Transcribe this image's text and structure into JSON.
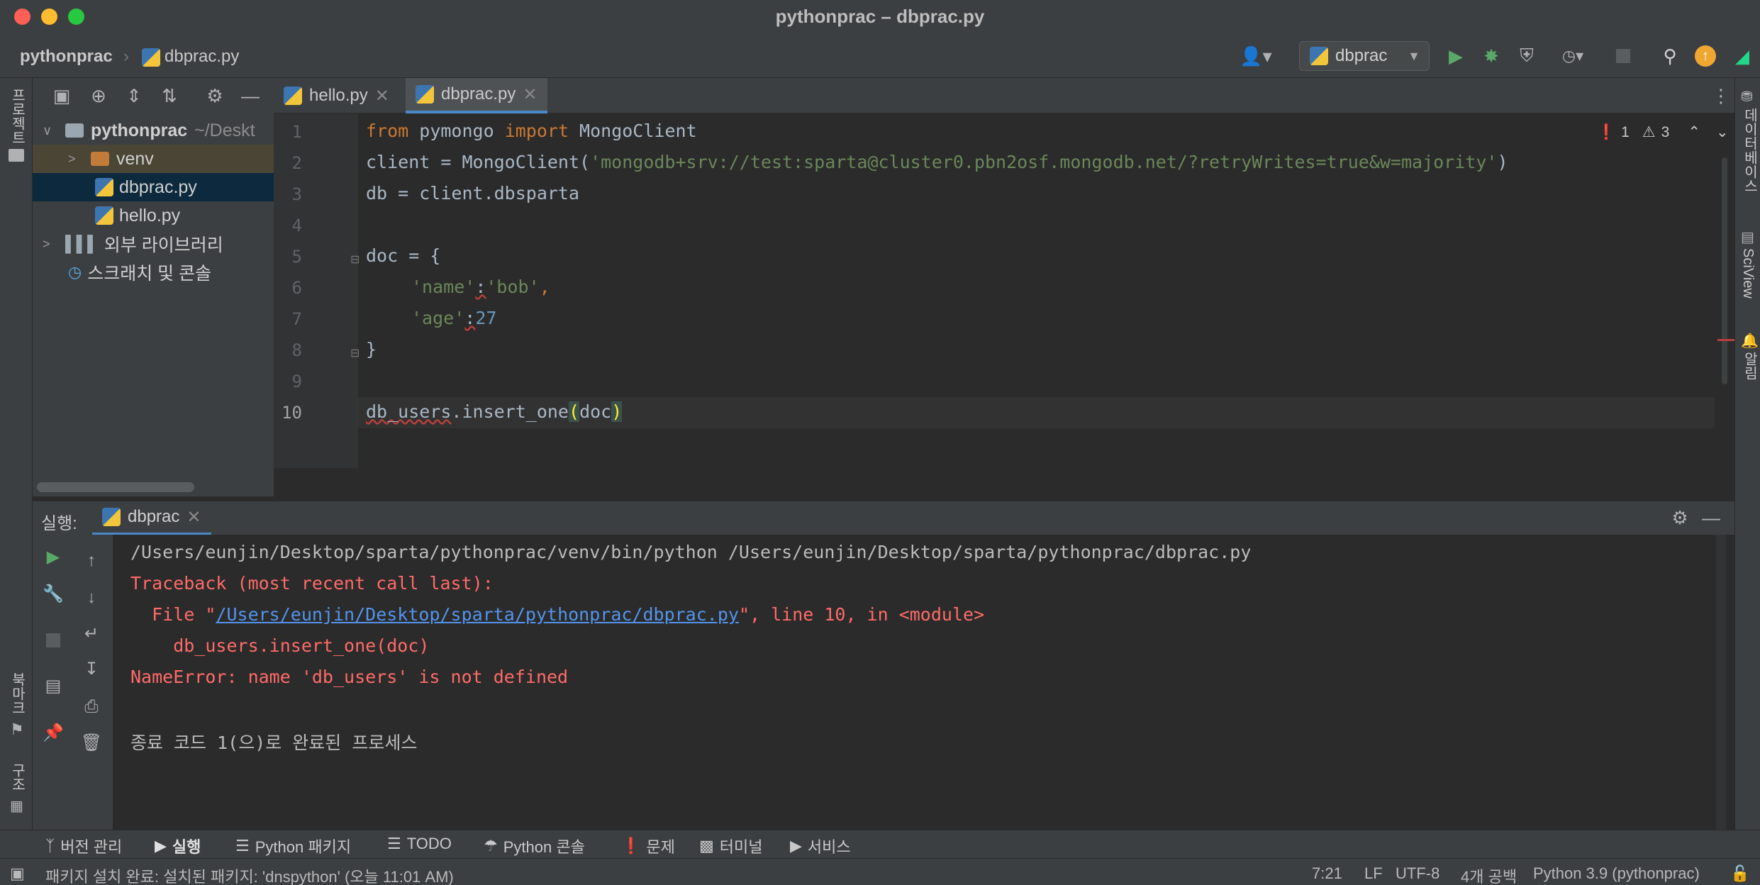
{
  "window": {
    "title": "pythonprac – dbprac.py",
    "colors": {
      "close": "#ff5f57",
      "minimize": "#febc2e",
      "maximize": "#28c840"
    }
  },
  "breadcrumb": {
    "project": "pythonprac",
    "file": "dbprac.py"
  },
  "toolbar": {
    "run_config": "dbprac",
    "icons": [
      "account-icon",
      "run-icon",
      "debug-icon",
      "coverage-icon",
      "profile-icon",
      "stop-icon",
      "search-icon",
      "update-icon",
      "jetbrains-icon"
    ]
  },
  "left_strip": {
    "project_label": "프로젝트",
    "bookmarks_label": "북마크",
    "structure_label": "구조"
  },
  "right_strip": {
    "database_label": "데이터베이스",
    "sciview_label": "SciView",
    "notifications_label": "알림"
  },
  "project_tree": {
    "root": "pythonprac",
    "root_path": "~/Deskt",
    "items": [
      {
        "label": "venv",
        "type": "folder"
      },
      {
        "label": "dbprac.py",
        "type": "python",
        "selected": true
      },
      {
        "label": "hello.py",
        "type": "python"
      },
      {
        "label": "외부 라이브러리",
        "type": "library"
      },
      {
        "label": "스크래치 및 콘솔",
        "type": "scratch"
      }
    ]
  },
  "editor": {
    "tabs": [
      {
        "label": "hello.py",
        "active": false
      },
      {
        "label": "dbprac.py",
        "active": true
      }
    ],
    "inspection": {
      "errors": "1",
      "warnings": "3"
    },
    "line_numbers": [
      "1",
      "2",
      "3",
      "4",
      "5",
      "6",
      "7",
      "8",
      "9",
      "10"
    ],
    "code": {
      "l1_from": "from",
      "l1_module": " pymongo ",
      "l1_import": "import",
      "l1_name": " MongoClient",
      "l2_head": "client = MongoClient(",
      "l2_str": "'mongodb+srv://test:sparta@cluster0.pbn2osf.mongodb.net/?retryWrites=true&w=majority'",
      "l2_tail": ")",
      "l3": "db = client.dbsparta",
      "l5": "doc = {",
      "l6_key": "'name'",
      "l6_colon": ":",
      "l6_val": "'bob'",
      "l6_comma": ",",
      "l7_key": "'age'",
      "l7_colon": ":",
      "l7_val": "27",
      "l8": "}",
      "l10_name": "db_users",
      "l10_call": ".insert_one",
      "l10_open": "(",
      "l10_arg": "doc",
      "l10_close": ")"
    }
  },
  "run_panel": {
    "label": "실행:",
    "tab": "dbprac",
    "output": {
      "cmd": "/Users/eunjin/Desktop/sparta/pythonprac/venv/bin/python /Users/eunjin/Desktop/sparta/pythonprac/dbprac.py",
      "traceback": "Traceback (most recent call last):",
      "file_prefix": "  File \"",
      "file_link": "/Users/eunjin/Desktop/sparta/pythonprac/dbprac.py",
      "file_suffix": "\", line 10, in <module>",
      "code_line": "    db_users.insert_one(doc)",
      "error": "NameError: name 'db_users' is not defined",
      "exit": "종료 코드 1(으)로 완료된 프로세스"
    }
  },
  "bottom_tools": [
    "버전 관리",
    "실행",
    "Python 패키지",
    "TODO",
    "Python 콘솔",
    "문제",
    "터미널",
    "서비스"
  ],
  "status_bar": {
    "message": "패키지 설치 완료: 설치된 패키지: 'dnspython' (오늘 11:01 AM)",
    "position": "7:21",
    "line_sep": "LF",
    "encoding": "UTF-8",
    "indent": "4개 공백",
    "interpreter": "Python 3.9 (pythonprac)"
  }
}
